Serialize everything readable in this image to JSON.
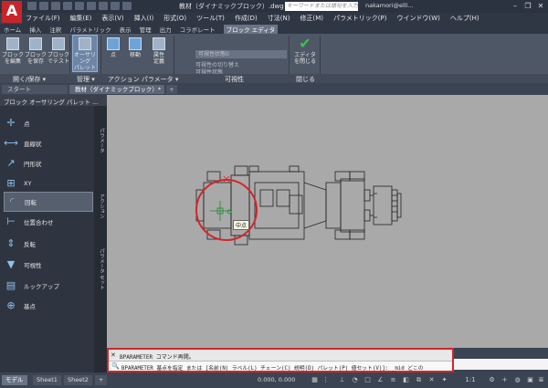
{
  "window": {
    "logo": "A",
    "title": "教材（ダイナミックブロック）.dwg",
    "search_placeholder": "キーワードまたは語句を入力",
    "user": "nakamori@elli...",
    "min": "–",
    "max": "❐",
    "close": "✕"
  },
  "menubar": {
    "items": [
      "ファイル(F)",
      "編集(E)",
      "表示(V)",
      "挿入(I)",
      "形式(O)",
      "ツール(T)",
      "作成(D)",
      "寸法(N)",
      "修正(M)",
      "パラメトリック(P)",
      "ウインドウ(W)",
      "ヘルプ(H)"
    ]
  },
  "ribbon_tabs": {
    "items": [
      "ホーム",
      "挿入",
      "注釈",
      "パラメトリック",
      "表示",
      "管理",
      "出力",
      "コラボレート"
    ],
    "active": "ブロック エディタ"
  },
  "ribbon": {
    "btn_save_block": "ブロック\nを編集",
    "btn_save_as": "ブロック\nを保存",
    "btn_test": "ブロック\nでテスト",
    "btn_authoring": "オーサリング\nパレット",
    "btn_point": "点",
    "btn_move": "移動",
    "btn_attr": "属性\n定義",
    "btn_close": "エディタ\nを閉じる",
    "visibility_dropdown": "可視性状態0",
    "vis_text1": "可視性の切り替え",
    "vis_text2": "可視性状態",
    "panel_open_save": "開く/保存 ▾",
    "panel_manage": "管理 ▾",
    "panel_action": "アクション パラメータ ▾",
    "panel_visibility": "可視性",
    "panel_close": "閉じる"
  },
  "doc_tabs": {
    "start": "スタート",
    "doc": "教材（ダイナミックブロック）*  ✕",
    "add": "+"
  },
  "palette": {
    "title": "ブロック オーサリング パレット ...",
    "items": [
      "点",
      "直線状",
      "円形状",
      "XY",
      "回転",
      "位置合わせ",
      "反転",
      "可視性",
      "ルックアップ",
      "基点"
    ],
    "selected_index": 4,
    "vtab1": "パラメータ",
    "vtab2": "アクション",
    "vtab3": "パラメータ セット"
  },
  "canvas": {
    "tooltip": "中点"
  },
  "command": {
    "history": "BPARAMETER コマンド再開。",
    "prompt": "BPARAMETER 基点を指定 または [名前(N) ラベル(L) チェーン(C) 説明(D) パレット(P) 値セット(V)]: _mid どこの",
    "close": "✕",
    "search": "🔍"
  },
  "status": {
    "tabs": [
      "モデル",
      "Sheet1",
      "Sheet2"
    ],
    "add": "+",
    "coords": "0.000, 0.000",
    "scale": "1:1"
  },
  "colors": {
    "highlight_red": "#d4242a",
    "canvas_bg": "#a9a9a9",
    "logo_red": "#c8252b"
  }
}
